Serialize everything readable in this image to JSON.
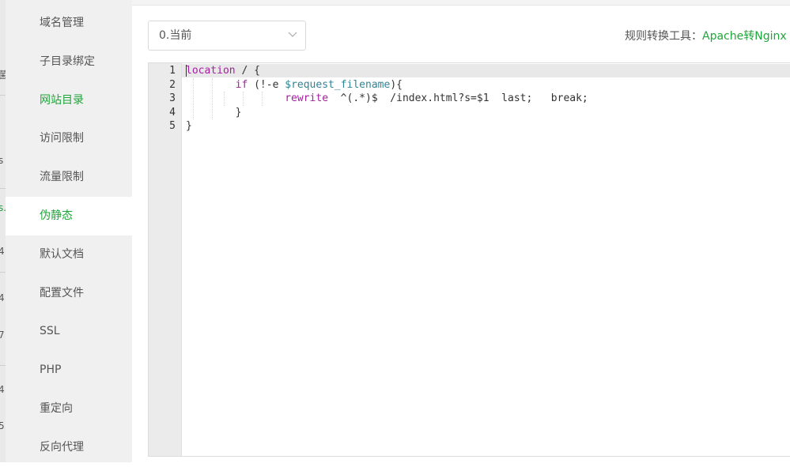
{
  "sidebar": {
    "items": [
      {
        "label": "域名管理"
      },
      {
        "label": "子目录绑定"
      },
      {
        "label": "网站目录"
      },
      {
        "label": "访问限制"
      },
      {
        "label": "流量限制"
      },
      {
        "label": "伪静态"
      },
      {
        "label": "默认文档"
      },
      {
        "label": "配置文件"
      },
      {
        "label": "SSL"
      },
      {
        "label": "PHP"
      },
      {
        "label": "重定向"
      },
      {
        "label": "反向代理"
      }
    ],
    "active_index": 5,
    "highlight_index": 2
  },
  "select": {
    "value": "0.当前"
  },
  "rule_tool": {
    "label": "规则转换工具：",
    "link": "Apache转Nginx"
  },
  "editor": {
    "line_numbers": [
      "1",
      "2",
      "3",
      "4",
      "5"
    ],
    "lines": [
      [
        {
          "t": "location",
          "c": "kw"
        },
        {
          "t": " / {",
          "c": "plain"
        }
      ],
      [
        {
          "t": "        ",
          "c": "plain"
        },
        {
          "t": "if",
          "c": "kw"
        },
        {
          "t": " (!-e ",
          "c": "plain"
        },
        {
          "t": "$request_filename",
          "c": "var"
        },
        {
          "t": "){",
          "c": "plain"
        }
      ],
      [
        {
          "t": "                ",
          "c": "plain"
        },
        {
          "t": "rewrite",
          "c": "cmd"
        },
        {
          "t": "  ^(.*)$  /index.html?s=$1  last;   break;",
          "c": "plain"
        }
      ],
      [
        {
          "t": "        }",
          "c": "plain"
        }
      ],
      [
        {
          "t": "}",
          "c": "plain"
        }
      ]
    ]
  },
  "background_fragments": [
    "菌",
    "s",
    "s.",
    "4",
    "4",
    "7",
    "4",
    "5"
  ],
  "colors": {
    "accent": "#20a53a",
    "sidebar_bg": "#f0f0f0",
    "gutter_bg": "#ebebeb"
  }
}
